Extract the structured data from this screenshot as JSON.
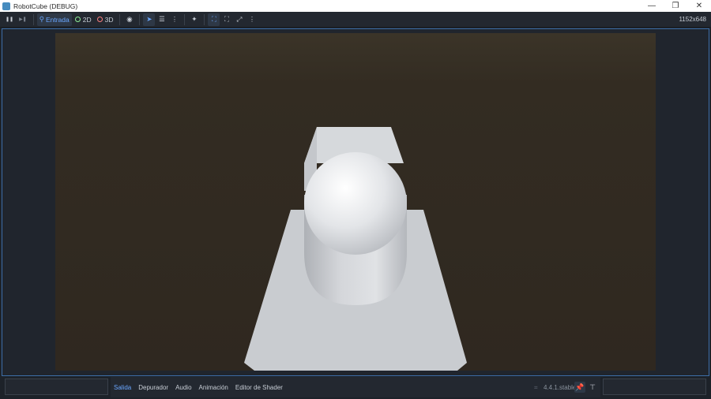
{
  "window": {
    "title": "RobotCube (DEBUG)",
    "minimize": "—",
    "restore": "❐",
    "close": "✕"
  },
  "toolbar": {
    "pause_icon": "❚❚",
    "step_icon": "▶❚",
    "input_label": "Entrada",
    "mode_2d_label": "2D",
    "mode_3d_label": "3D",
    "resolution": "1152x648"
  },
  "bottom": {
    "tabs": [
      "Salida",
      "Depurador",
      "Audio",
      "Animación",
      "Editor de Shader"
    ],
    "active_tab": "Salida",
    "version": "4.4.1.stable"
  },
  "colors": {
    "accent": "#6aa7ff",
    "sky_top": "#3b3428",
    "sky": "#332c22",
    "floor": "#c9ccd0",
    "box": "#d0d3d7",
    "capsule": "#dcdee1"
  }
}
